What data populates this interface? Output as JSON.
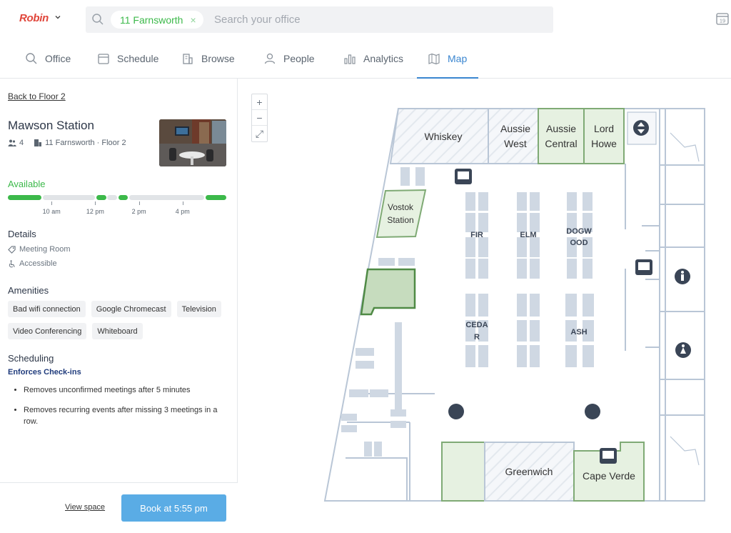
{
  "app": {
    "brand": "Robin"
  },
  "search": {
    "chip_label": "11 Farnsworth",
    "chip_clear": "×",
    "placeholder": "Search your office"
  },
  "calendar": {
    "day": "19"
  },
  "nav": {
    "tabs": [
      {
        "label": "Office",
        "icon": "search-icon"
      },
      {
        "label": "Schedule",
        "icon": "calendar-icon"
      },
      {
        "label": "Browse",
        "icon": "building-icon"
      },
      {
        "label": "People",
        "icon": "person-icon"
      },
      {
        "label": "Analytics",
        "icon": "bar-chart-icon"
      },
      {
        "label": "Map",
        "icon": "map-icon",
        "active": true
      }
    ]
  },
  "space": {
    "back_link": "Back to Floor 2",
    "name": "Mawson Station",
    "capacity": "4",
    "location": "11 Farnsworth · Floor 2",
    "status": "Available",
    "status_color": "#3cb94a",
    "busy_color": "#e1e4e7",
    "timeline": {
      "segments": [
        {
          "from": 0.0,
          "to": 0.155,
          "state": "free"
        },
        {
          "from": 0.16,
          "to": 0.4,
          "state": "busy"
        },
        {
          "from": 0.405,
          "to": 0.45,
          "state": "free"
        },
        {
          "from": 0.455,
          "to": 0.5,
          "state": "busy"
        },
        {
          "from": 0.505,
          "to": 0.55,
          "state": "free"
        },
        {
          "from": 0.555,
          "to": 0.9,
          "state": "busy"
        },
        {
          "from": 0.905,
          "to": 1.0,
          "state": "free"
        }
      ],
      "ticks": [
        {
          "label": "10 am",
          "pos": 0.2
        },
        {
          "label": "12 pm",
          "pos": 0.4
        },
        {
          "label": "2 pm",
          "pos": 0.6
        },
        {
          "label": "4 pm",
          "pos": 0.8
        }
      ]
    },
    "details_heading": "Details",
    "details": [
      {
        "label": "Meeting Room",
        "icon": "tag-icon"
      },
      {
        "label": "Accessible",
        "icon": "accessible-icon"
      }
    ],
    "amenities_heading": "Amenities",
    "amenities": [
      "Bad wifi connection",
      "Google Chromecast",
      "Television",
      "Video Conferencing",
      "Whiteboard"
    ],
    "scheduling_heading": "Scheduling",
    "enforces": "Enforces Check-ins",
    "rules": [
      "Removes unconfirmed meetings after 5 minutes",
      "Removes recurring events after missing 3 meetings in a row."
    ],
    "view_link": "View space",
    "book_button": "Book at 5:55 pm"
  },
  "map": {
    "zoom_in": "+",
    "zoom_out": "−",
    "fit": "⤢",
    "rooms": [
      {
        "name": "Whiskey",
        "state": "unavailable"
      },
      {
        "name": "Aussie West",
        "line1": "Aussie",
        "line2": "West",
        "state": "unavailable"
      },
      {
        "name": "Aussie Central",
        "line1": "Aussie",
        "line2": "Central",
        "state": "available"
      },
      {
        "name": "Lord Howe",
        "line1": "Lord",
        "line2": "Howe",
        "state": "available"
      },
      {
        "name": "Vostok Station",
        "line1": "Vostok",
        "line2": "Station",
        "state": "available"
      },
      {
        "name": "Greenwich",
        "state": "unavailable"
      },
      {
        "name": "Cape Verde",
        "state": "available"
      }
    ],
    "desk_groups": [
      {
        "line1": "FIR",
        "line2": ""
      },
      {
        "line1": "ELM",
        "line2": ""
      },
      {
        "line1": "DOGW",
        "line2": "OOD"
      },
      {
        "line1": "CEDA",
        "line2": "R"
      },
      {
        "line1": "ASH",
        "line2": ""
      }
    ],
    "colors": {
      "available_fill": "#e6f1e1",
      "available_stroke": "#7faa75",
      "selected_fill": "#c6dcbe",
      "selected_stroke": "#4f8a45",
      "wall": "#b9c6d6",
      "desk": "#cfd8e3",
      "icon": "#3a4556"
    }
  }
}
